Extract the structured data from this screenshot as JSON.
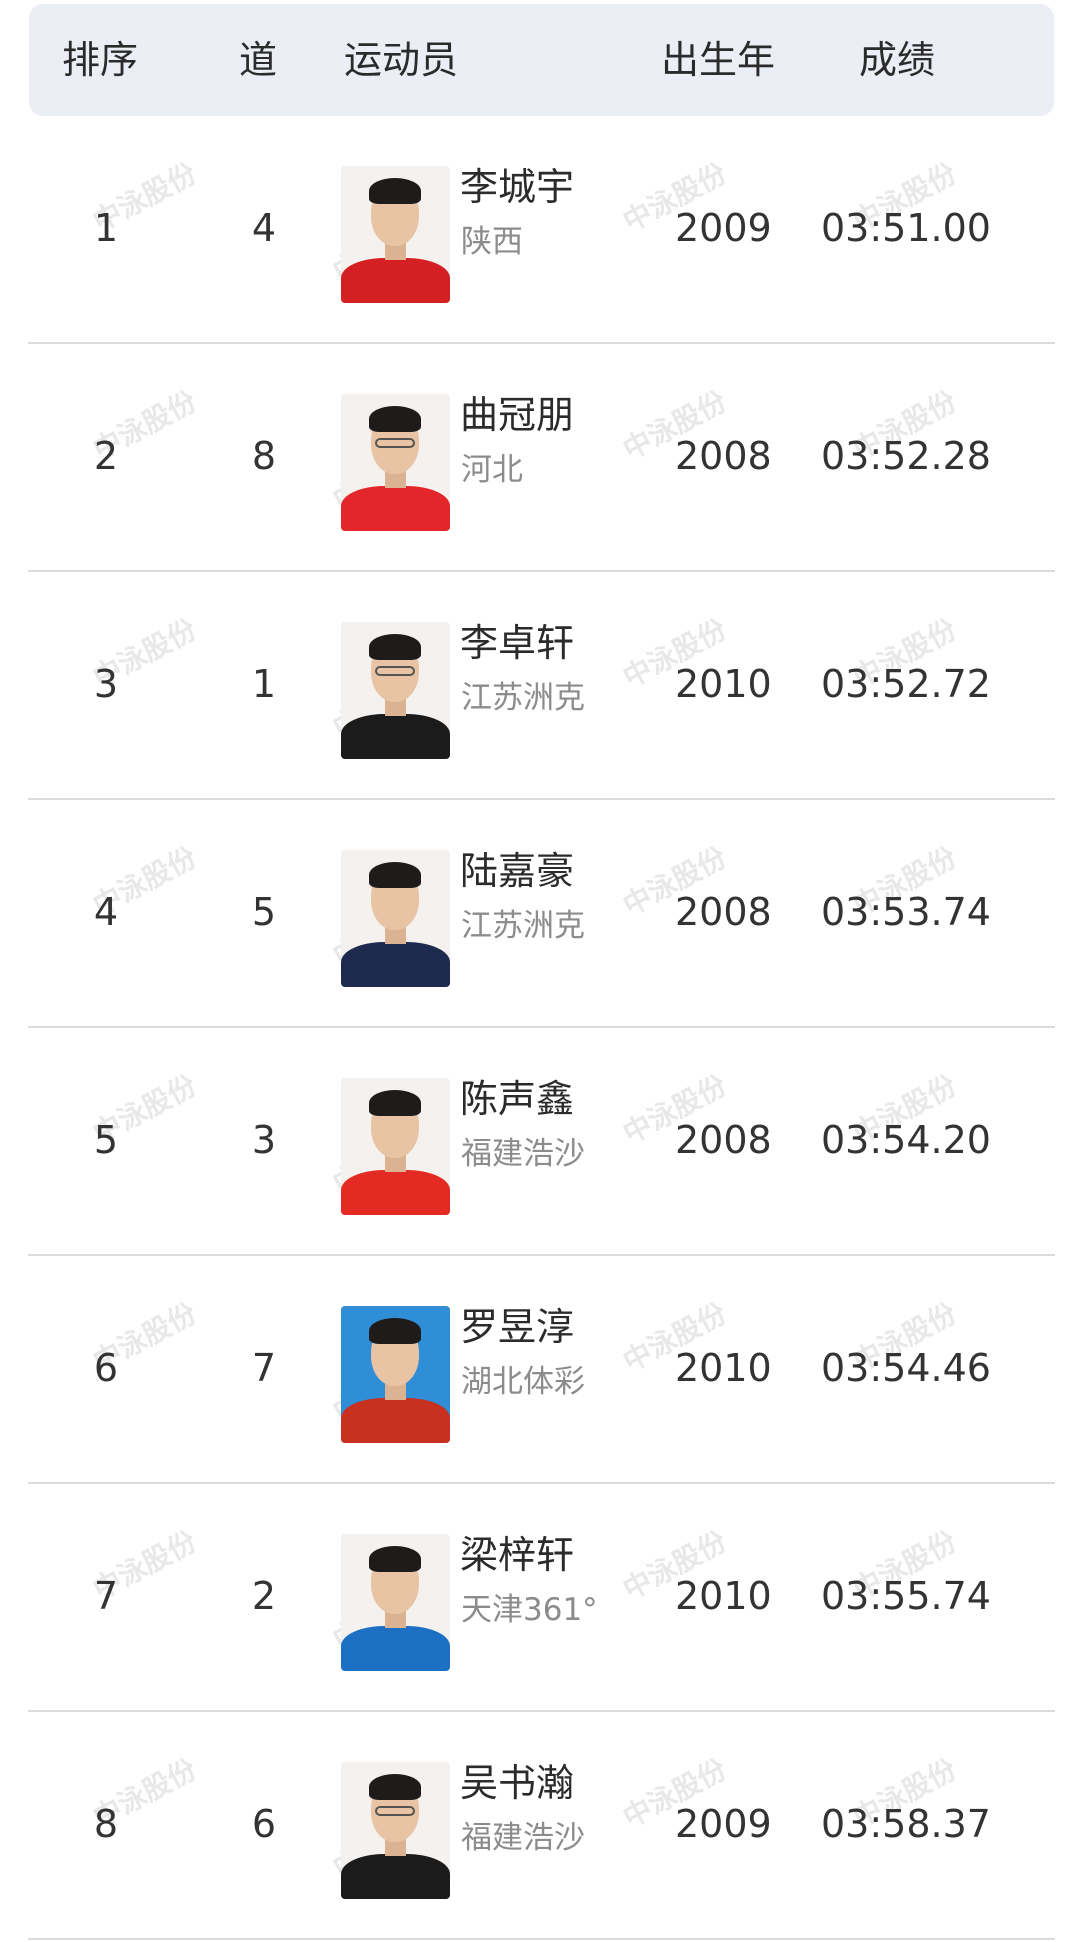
{
  "header": {
    "rank": "排序",
    "lane": "道",
    "athlete": "运动员",
    "birth_year": "出生年",
    "result": "成绩"
  },
  "watermark": "中泳股份",
  "rows": [
    {
      "rank": "1",
      "lane": "4",
      "name": "李城宇",
      "team": "陕西",
      "birth_year": "2009",
      "result": "03:51.00",
      "uniform_color": "#d42022",
      "photo_bg": "light"
    },
    {
      "rank": "2",
      "lane": "8",
      "name": "曲冠朋",
      "team": "河北",
      "birth_year": "2008",
      "result": "03:52.28",
      "uniform_color": "#e3262a",
      "photo_bg": "light"
    },
    {
      "rank": "3",
      "lane": "1",
      "name": "李卓轩",
      "team": "江苏洲克",
      "birth_year": "2010",
      "result": "03:52.72",
      "uniform_color": "#1b1b1b",
      "photo_bg": "light"
    },
    {
      "rank": "4",
      "lane": "5",
      "name": "陆嘉豪",
      "team": "江苏洲克",
      "birth_year": "2008",
      "result": "03:53.74",
      "uniform_color": "#1d2a4d",
      "photo_bg": "light"
    },
    {
      "rank": "5",
      "lane": "3",
      "name": "陈声鑫",
      "team": "福建浩沙",
      "birth_year": "2008",
      "result": "03:54.20",
      "uniform_color": "#e32b24",
      "photo_bg": "light"
    },
    {
      "rank": "6",
      "lane": "7",
      "name": "罗昱淳",
      "team": "湖北体彩",
      "birth_year": "2010",
      "result": "03:54.46",
      "uniform_color": "#c8301f",
      "photo_bg": "blue"
    },
    {
      "rank": "7",
      "lane": "2",
      "name": "梁梓轩",
      "team": "天津361°",
      "birth_year": "2010",
      "result": "03:55.74",
      "uniform_color": "#1d6fc4",
      "photo_bg": "light"
    },
    {
      "rank": "8",
      "lane": "6",
      "name": "吴书瀚",
      "team": "福建浩沙",
      "birth_year": "2009",
      "result": "03:58.37",
      "uniform_color": "#1b1b1b",
      "photo_bg": "light"
    }
  ]
}
